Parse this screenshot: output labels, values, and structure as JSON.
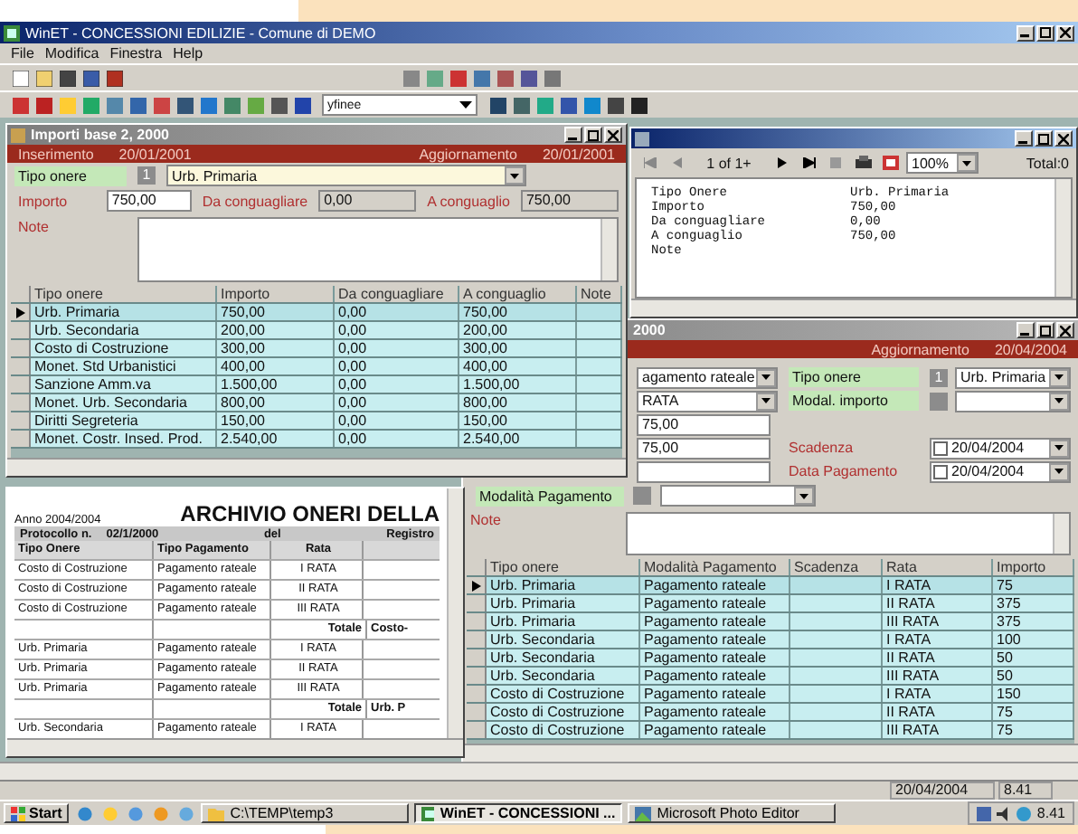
{
  "app": {
    "title": "WinET - CONCESSIONI EDILIZIE - Comune di DEMO",
    "menu": [
      "File",
      "Modifica",
      "Finestra",
      "Help"
    ],
    "toolbar_combo": "yfinee"
  },
  "importi": {
    "title": "Importi base 2, 2000",
    "inserted_label": "Inserimento",
    "inserted_date": "20/01/2001",
    "updated_label": "Aggiornamento",
    "updated_date": "20/01/2001",
    "tipo_onere_label": "Tipo onere",
    "tipo_onere_code": "1",
    "tipo_onere_value": "Urb. Primaria",
    "importo_label": "Importo",
    "importo_value": "750,00",
    "da_conguagliare_label": "Da conguagliare",
    "da_conguagliare_value": "0,00",
    "a_conguaglio_label": "A conguaglio",
    "a_conguaglio_value": "750,00",
    "note_label": "Note",
    "columns": [
      "Tipo onere",
      "Importo",
      "Da conguagliare",
      "A conguaglio",
      "Note"
    ],
    "rows": [
      {
        "cells": [
          "Urb. Primaria",
          "750,00",
          "0,00",
          "750,00"
        ],
        "selected": true
      },
      {
        "cells": [
          "Urb. Secondaria",
          "200,00",
          "0,00",
          "200,00"
        ],
        "selected": false
      },
      {
        "cells": [
          "Costo di Costruzione",
          "300,00",
          "0,00",
          "300,00"
        ],
        "selected": false
      },
      {
        "cells": [
          "Monet. Std Urbanistici",
          "400,00",
          "0,00",
          "400,00"
        ],
        "selected": false
      },
      {
        "cells": [
          "Sanzione Amm.va",
          "1.500,00",
          "0,00",
          "1.500,00"
        ],
        "selected": false
      },
      {
        "cells": [
          "Monet. Urb. Secondaria",
          "800,00",
          "0,00",
          "800,00"
        ],
        "selected": false
      },
      {
        "cells": [
          "Diritti Segreteria",
          "150,00",
          "0,00",
          "150,00"
        ],
        "selected": false
      },
      {
        "cells": [
          "Monet. Costr. Insed. Prod.",
          "2.540,00",
          "0,00",
          "2.540,00"
        ],
        "selected": false
      }
    ]
  },
  "preview": {
    "page": "1 of 1+",
    "zoom": "100%",
    "total": "Total:0",
    "lines": [
      {
        "label": "Tipo Onere",
        "value": "Urb. Primaria"
      },
      {
        "label": "Importo",
        "value": "750,00"
      },
      {
        "label": "Da conguagliare",
        "value": "0,00"
      },
      {
        "label": "A conguaglio",
        "value": "750,00"
      },
      {
        "label": "Note"
      }
    ]
  },
  "rate": {
    "title": "2000",
    "updated_label": "Aggiornamento",
    "updated_date": "20/04/2004",
    "modalita_value": "agamento rateale",
    "rata_value": "RATA",
    "amount_1": "75,00",
    "amount_2": "75,00",
    "tipo_onere_label": "Tipo onere",
    "tipo_onere_code": "1",
    "tipo_onere_value": "Urb. Primaria",
    "modal_importo_label": "Modal. importo",
    "scadenza_label": "Scadenza",
    "scadenza_value": "20/04/2004",
    "data_pagamento_label": "Data Pagamento",
    "data_pagamento_value": "20/04/2004",
    "modalita_pagamento_label": "Modalità Pagamento",
    "note_label": "Note",
    "columns": [
      "Tipo onere",
      "Modalità Pagamento",
      "Scadenza",
      "Rata",
      "Importo"
    ],
    "rows": [
      {
        "cells": [
          "Urb. Primaria",
          "Pagamento rateale",
          "",
          "I RATA",
          "75"
        ],
        "selected": true
      },
      {
        "cells": [
          "Urb. Primaria",
          "Pagamento rateale",
          "",
          "II RATA",
          "375"
        ],
        "selected": false
      },
      {
        "cells": [
          "Urb. Primaria",
          "Pagamento rateale",
          "",
          "III RATA",
          "375"
        ],
        "selected": false
      },
      {
        "cells": [
          "Urb. Secondaria",
          "Pagamento rateale",
          "",
          "I RATA",
          "100"
        ],
        "selected": false
      },
      {
        "cells": [
          "Urb. Secondaria",
          "Pagamento rateale",
          "",
          "II RATA",
          "50"
        ],
        "selected": false
      },
      {
        "cells": [
          "Urb. Secondaria",
          "Pagamento rateale",
          "",
          "III RATA",
          "50"
        ],
        "selected": false
      },
      {
        "cells": [
          "Costo di Costruzione",
          "Pagamento rateale",
          "",
          "I RATA",
          "150"
        ],
        "selected": false
      },
      {
        "cells": [
          "Costo di Costruzione",
          "Pagamento rateale",
          "",
          "II RATA",
          "75"
        ],
        "selected": false
      },
      {
        "cells": [
          "Costo di Costruzione",
          "Pagamento rateale",
          "",
          "III RATA",
          "75"
        ],
        "selected": false
      }
    ]
  },
  "archivio": {
    "heading": "ARCHIVIO ONERI DELLA",
    "anno": "Anno 2004/2004",
    "protocol_label": "Protocollo n.",
    "protocol_value": "02/1/2000",
    "del_label": "del",
    "registro_label": "Registro",
    "columns": [
      "Tipo Onere",
      "Tipo Pagamento",
      "Rata"
    ],
    "rows": [
      {
        "kind": "detail",
        "cells": [
          "Costo di Costruzione",
          "Pagamento rateale",
          "I RATA"
        ]
      },
      {
        "kind": "detail",
        "cells": [
          "Costo di Costruzione",
          "Pagamento rateale",
          "II RATA"
        ]
      },
      {
        "kind": "detail",
        "cells": [
          "Costo di Costruzione",
          "Pagamento rateale",
          "III RATA"
        ]
      },
      {
        "kind": "total",
        "cells": [
          "Totale",
          "Costo-"
        ]
      },
      {
        "kind": "detail",
        "cells": [
          "Urb. Primaria",
          "Pagamento rateale",
          "I RATA"
        ]
      },
      {
        "kind": "detail",
        "cells": [
          "Urb. Primaria",
          "Pagamento rateale",
          "II RATA"
        ]
      },
      {
        "kind": "detail",
        "cells": [
          "Urb. Primaria",
          "Pagamento rateale",
          "III RATA"
        ]
      },
      {
        "kind": "total",
        "cells": [
          "Totale",
          "Urb. P"
        ]
      },
      {
        "kind": "detail",
        "cells": [
          "Urb. Secondaria",
          "Pagamento rateale",
          "I RATA"
        ]
      }
    ]
  },
  "status_bar": {
    "date": "20/04/2004",
    "time": "8.41"
  },
  "taskbar": {
    "start": "Start",
    "tasks": [
      {
        "kind": "folder",
        "label": "C:\\TEMP\\temp3",
        "selected": false
      },
      {
        "kind": "app",
        "label": "WinET - CONCESSIONI ...",
        "selected": true
      },
      {
        "kind": "photo",
        "label": "Microsoft Photo Editor",
        "selected": false
      }
    ],
    "clock": "8.41"
  }
}
